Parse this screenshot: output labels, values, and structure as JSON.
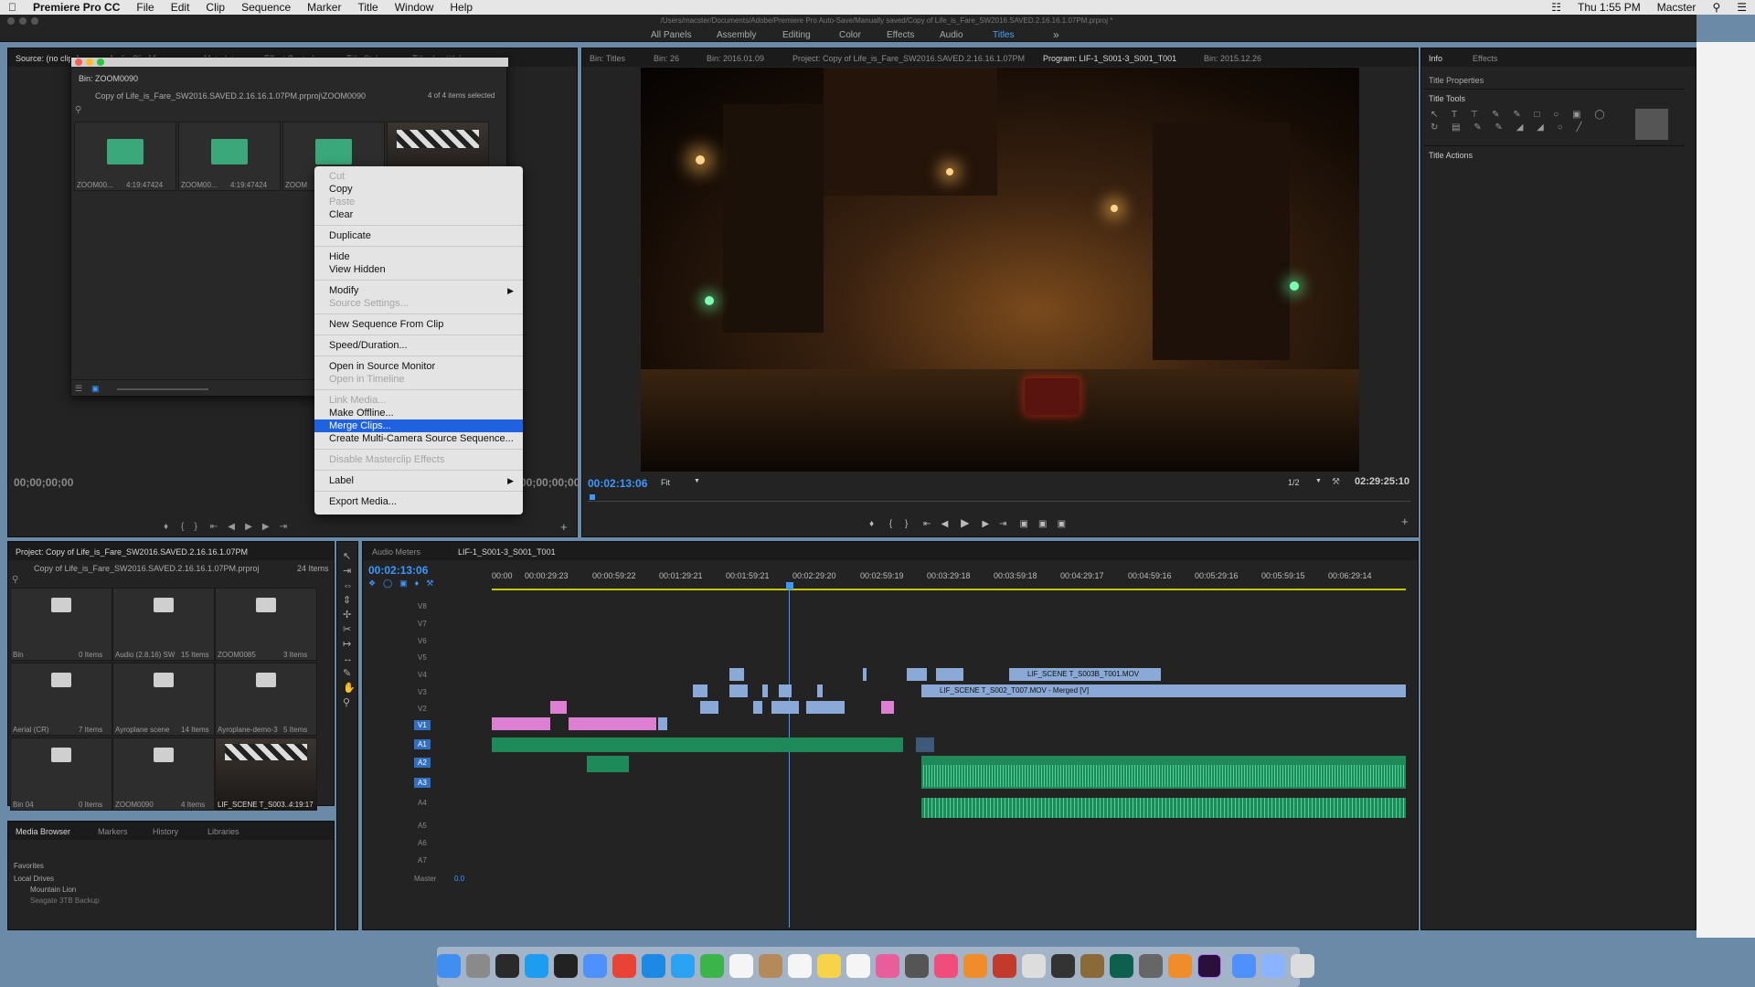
{
  "menubar": {
    "apple": "",
    "app_name": "Premiere Pro CC",
    "items": [
      "File",
      "Edit",
      "Clip",
      "Sequence",
      "Marker",
      "Title",
      "Window",
      "Help"
    ],
    "clock": "Thu 1:55 PM",
    "user": "Macster"
  },
  "window_title": "/Users/macster/Documents/Adobe/Premiere Pro Auto-Save/Manually saved/Copy of Life_is_Fare_SW2016.SAVED.2.16.16.1.07PM.prproj *",
  "workspaces": [
    "All Panels",
    "Assembly",
    "Editing",
    "Color",
    "Effects",
    "Audio",
    "Titles"
  ],
  "workspace_active": "Titles",
  "source_panel": {
    "tabs": [
      "Source: (no clips)",
      "Audio Clip Mixer",
      "Metadata",
      "Effect Controls",
      "Title Styles",
      "Title: (no title)"
    ],
    "timecode_left": "00;00;00;00",
    "timecode_right": "00;00;00;00"
  },
  "bin_window": {
    "title": "Bin: ZOOM0090",
    "path": "Copy of Life_is_Fare_SW2016.SAVED.2.16.16.1.07PM.prproj\\ZOOM0090",
    "selection": "4 of 4 items selected",
    "items": [
      {
        "name": "ZOOM00...",
        "duration": "4:19:47424"
      },
      {
        "name": "ZOOM00...",
        "duration": "4:19:47424"
      },
      {
        "name": "ZOOM",
        "duration": ""
      },
      {
        "name": "",
        "duration": ""
      }
    ]
  },
  "context_menu": {
    "items": [
      {
        "label": "Cut",
        "enabled": false
      },
      {
        "label": "Copy",
        "enabled": true
      },
      {
        "label": "Paste",
        "enabled": false
      },
      {
        "label": "Clear",
        "enabled": true
      },
      {
        "label": "Duplicate",
        "enabled": true
      },
      {
        "label": "Hide",
        "enabled": true
      },
      {
        "label": "View Hidden",
        "enabled": true
      },
      {
        "label": "Modify",
        "enabled": true,
        "submenu": true
      },
      {
        "label": "Source Settings...",
        "enabled": false
      },
      {
        "label": "New Sequence From Clip",
        "enabled": true
      },
      {
        "label": "Speed/Duration...",
        "enabled": true
      },
      {
        "label": "Open in Source Monitor",
        "enabled": true
      },
      {
        "label": "Open in Timeline",
        "enabled": false
      },
      {
        "label": "Link Media...",
        "enabled": false
      },
      {
        "label": "Make Offline...",
        "enabled": true
      },
      {
        "label": "Merge Clips...",
        "enabled": true,
        "highlighted": true
      },
      {
        "label": "Create Multi-Camera Source Sequence...",
        "enabled": true
      },
      {
        "label": "Disable Masterclip Effects",
        "enabled": false
      },
      {
        "label": "Label",
        "enabled": true,
        "submenu": true
      },
      {
        "label": "Export Media...",
        "enabled": true
      }
    ]
  },
  "program_panel": {
    "tabs": [
      "Bin: Titles",
      "Bin: 26",
      "Bin: 2016.01.09",
      "Project: Copy of Life_is_Fare_SW2016.SAVED.2.16.16.1.07PM",
      "Program: LIF-1_S001-3_S001_T001",
      "Bin: 2015.12.26"
    ],
    "active_tab": "Program: LIF-1_S001-3_S001_T001",
    "timecode": "00:02:13:06",
    "fit": "Fit",
    "resolution": "1/2",
    "duration": "02:29:25:10"
  },
  "right_panel": {
    "tabs": [
      "Info",
      "Effects"
    ],
    "title_properties": "Title Properties",
    "title_tools": "Title Tools",
    "title_actions": "Title Actions"
  },
  "project_panel": {
    "tab": "Project: Copy of Life_is_Fare_SW2016.SAVED.2.16.16.1.07PM",
    "path": "Copy of Life_is_Fare_SW2016.SAVED.2.16.16.1.07PM.prproj",
    "count": "24 Items",
    "items": [
      {
        "name": "Bin",
        "count": "0 Items"
      },
      {
        "name": "Audio (2.8.16) SW",
        "count": "15 Items"
      },
      {
        "name": "ZOOM0085",
        "count": "3 Items"
      },
      {
        "name": "Aerial (CR)",
        "count": "7 Items"
      },
      {
        "name": "Ayroplane scene",
        "count": "14 Items"
      },
      {
        "name": "Ayroplane-demo-3",
        "count": "5 Items"
      },
      {
        "name": "Bin 04",
        "count": "0 Items"
      },
      {
        "name": "ZOOM0090",
        "count": "4 Items"
      },
      {
        "name": "LIF_SCENE T_S003...",
        "count": "4:19:17"
      }
    ]
  },
  "media_browser": {
    "tabs": [
      "Media Browser",
      "Markers",
      "History",
      "Libraries"
    ],
    "tree": [
      "Favorites",
      "Local Drives",
      "Mountain Lion",
      "Seagate 3TB Backup"
    ]
  },
  "timeline": {
    "tabs": [
      "Audio Meters",
      "LIF-1_S001-3_S001_T001"
    ],
    "timecode": "00:02:13:06",
    "ruler": [
      "00:00",
      "00:00:29:23",
      "00:00:59:22",
      "00:01:29:21",
      "00:01:59:21",
      "00:02:29:20",
      "00:02:59:19",
      "00:03:29:18",
      "00:03:59:18",
      "00:04:29:17",
      "00:04:59:16",
      "00:05:29:16",
      "00:05:59:15",
      "00:06:29:14"
    ],
    "video_tracks": [
      "V8",
      "V7",
      "V6",
      "V5",
      "V4",
      "V3",
      "V2",
      "V1"
    ],
    "audio_tracks": [
      "A1",
      "A2",
      "A3",
      "A4",
      "A5",
      "A6",
      "A7"
    ],
    "master": "Master",
    "master_value": "0.0",
    "clip_labels": [
      "LIF_SCENE T_S003B_T001.MOV",
      "LIF_SCENE T_S002_T007.MOV - Merged [V]"
    ]
  },
  "colors": {
    "accent": "#3b98ff",
    "video_clip": "#8aa9d6",
    "pink_clip": "#dd7fd3",
    "audio_clip": "#1e8a5a",
    "menu_highlight": "#1f62e0"
  }
}
